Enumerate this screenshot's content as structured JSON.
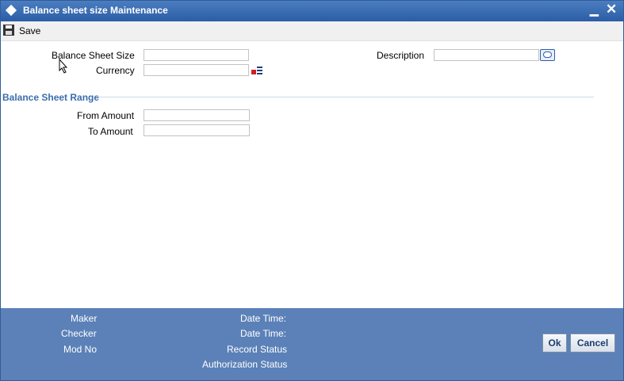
{
  "window": {
    "title": "Balance sheet size Maintenance",
    "minimize_glyph": "▁",
    "close_glyph": "✕"
  },
  "toolbar": {
    "save_label": "Save"
  },
  "form": {
    "balance_sheet_size_label": "Balance Sheet Size",
    "balance_sheet_size_value": "",
    "currency_label": "Currency",
    "currency_value": "",
    "description_label": "Description",
    "description_value": ""
  },
  "range": {
    "heading": "Balance Sheet Range",
    "from_label": "From Amount",
    "from_value": "",
    "to_label": "To Amount",
    "to_value": ""
  },
  "footer": {
    "maker_label": "Maker",
    "checker_label": "Checker",
    "mod_no_label": "Mod No",
    "date_time_label_1": "Date Time:",
    "date_time_label_2": "Date Time:",
    "record_status_label": "Record Status",
    "authorization_status_label": "Authorization Status",
    "ok_label": "Ok",
    "cancel_label": "Cancel"
  },
  "icons": {
    "title": "diamond-icon",
    "save": "floppy-disk-icon",
    "lov": "list-of-values-icon",
    "description": "speech-bubble-icon",
    "cursor": "mouse-pointer-icon"
  },
  "colors": {
    "titlebar": "#2b5ea6",
    "footer": "#5b81b8",
    "section_heading": "#3b6dad"
  }
}
